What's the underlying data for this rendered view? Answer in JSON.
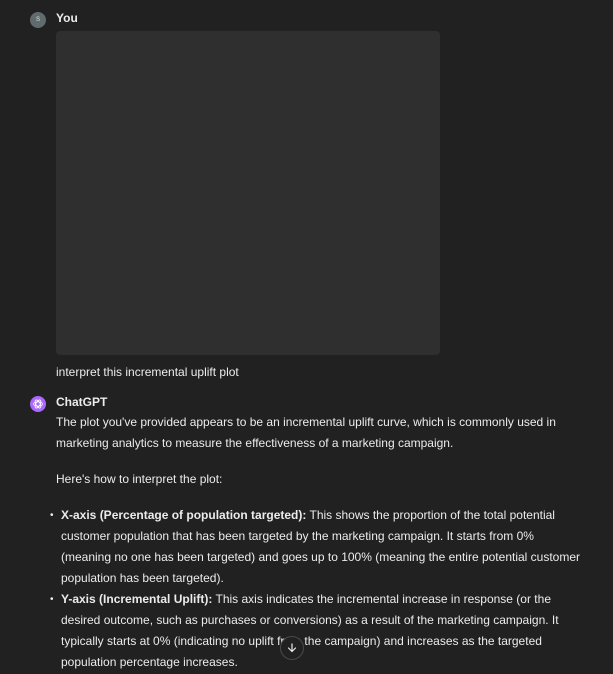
{
  "user_message": {
    "avatar_initials": "S",
    "author": "You",
    "text": "interpret this incremental uplift plot"
  },
  "assistant_message": {
    "author": "ChatGPT",
    "intro": "The plot you've provided appears to be an incremental uplift curve, which is commonly used in marketing analytics to measure the effectiveness of a marketing campaign.",
    "lead": "Here's how to interpret the plot:",
    "points": [
      {
        "title": "X-axis (Percentage of population targeted):",
        "text": " This shows the proportion of the total potential customer population that has been targeted by the marketing campaign. It starts from 0% (meaning no one has been targeted) and goes up to 100% (meaning the entire potential customer population has been targeted)."
      },
      {
        "title": "Y-axis (Incremental Uplift):",
        "text": " This axis indicates the incremental increase in response (or the desired outcome, such as purchases or conversions) as a result of the marketing campaign. It typically starts at 0% (indicating no uplift from the campaign) and increases as the targeted population percentage increases."
      }
    ]
  },
  "icons": {
    "assistant_avatar": "openai-logo-icon",
    "scroll_down": "arrow-down-icon"
  },
  "colors": {
    "background": "#212121",
    "image_placeholder": "#2f2f2f",
    "assistant_avatar": "#ab68ff",
    "text": "#ececec"
  }
}
